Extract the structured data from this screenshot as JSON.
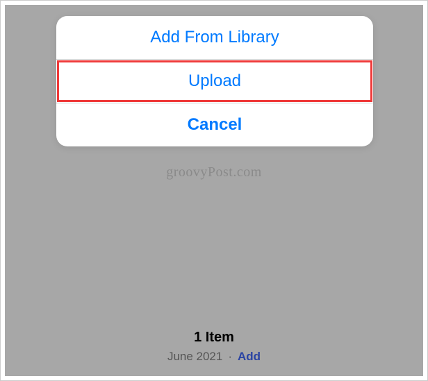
{
  "action_sheet": {
    "add_from_library": "Add From Library",
    "upload": "Upload",
    "cancel": "Cancel"
  },
  "watermark": "groovyPost.com",
  "bottom": {
    "item_count": "1 Item",
    "date": "June 2021",
    "separator": "·",
    "add_label": "Add"
  }
}
